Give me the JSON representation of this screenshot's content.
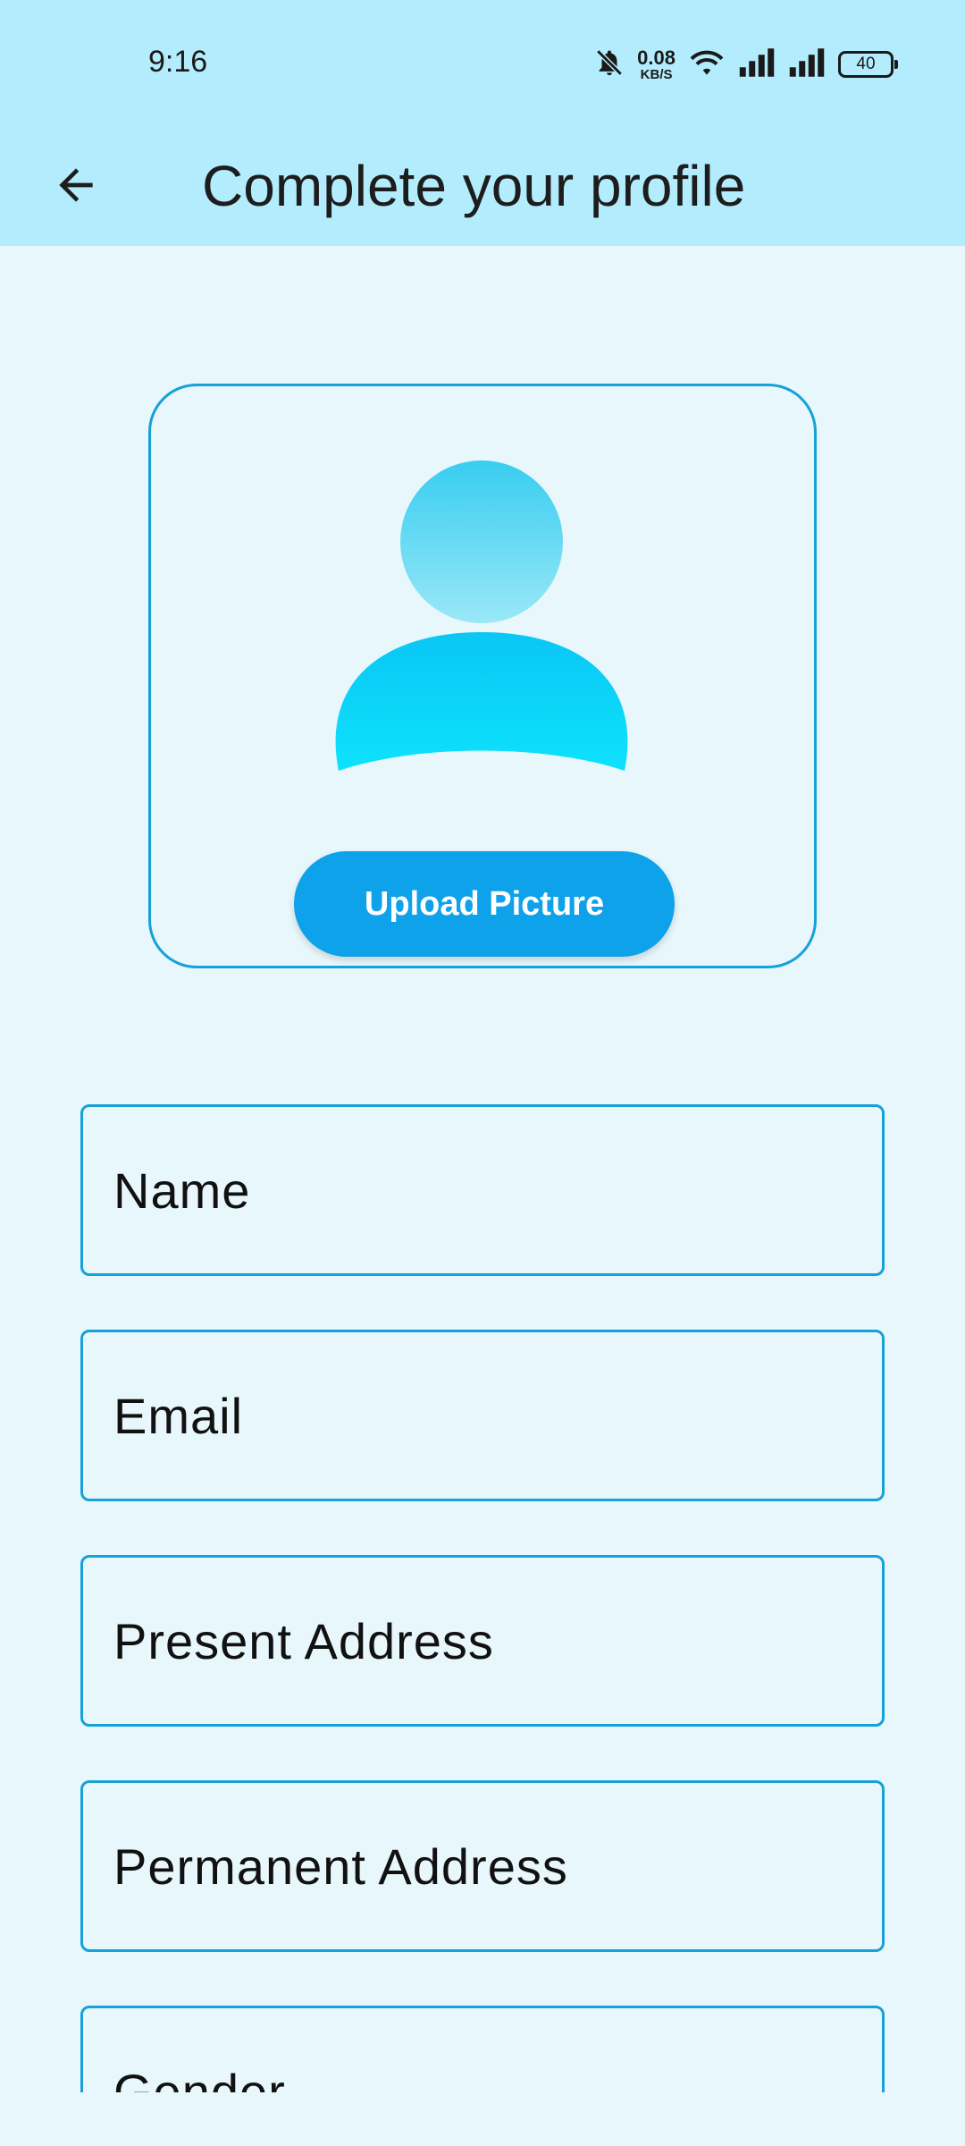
{
  "status_bar": {
    "time": "9:16",
    "net_speed_value": "0.08",
    "net_speed_unit": "KB/S",
    "battery": "40",
    "icons": [
      "bell-off-icon",
      "wifi-icon",
      "signal-icon",
      "signal-icon",
      "battery-icon"
    ]
  },
  "app_bar": {
    "back_icon": "arrow-left-icon",
    "title": "Complete your profile"
  },
  "profile_picture": {
    "upload_label": "Upload Picture"
  },
  "form": {
    "fields": [
      {
        "label": "Name"
      },
      {
        "label": "Email"
      },
      {
        "label": "Present Address"
      },
      {
        "label": "Permanent Address"
      },
      {
        "label": "Gender"
      }
    ]
  },
  "colors": {
    "header_bg": "#b3edfd",
    "page_bg": "#e8f7fc",
    "accent": "#16a1d8",
    "button": "#0ea2ea"
  }
}
